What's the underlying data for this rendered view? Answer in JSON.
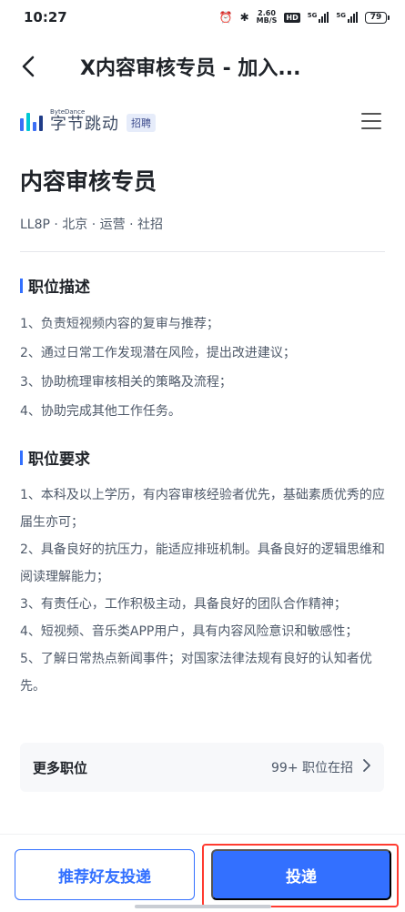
{
  "status_bar": {
    "time": "10:27",
    "net_speed_value": "2.60",
    "net_speed_unit": "MB/S",
    "hd_label": "HD",
    "sig1_label": "5G",
    "sig2_label": "5G",
    "battery": "79"
  },
  "nav": {
    "title": "X内容审核专员 - 加入..."
  },
  "brand": {
    "en": "ByteDance",
    "cn": "字节跳动",
    "tag": "招聘",
    "logo_colors": [
      "#3c6ff5",
      "#00c8d4",
      "#3c6ff5",
      "#1f3c88"
    ]
  },
  "job": {
    "title": "内容审核专员",
    "meta": "LL8P · 北京 · 运营 · 社招"
  },
  "description": {
    "title": "职位描述",
    "items": [
      "1、负责短视频内容的复审与推荐；",
      "2、通过日常工作发现潜在风险，提出改进建议；",
      "3、协助梳理审核相关的策略及流程；",
      "4、协助完成其他工作任务。"
    ]
  },
  "requirements": {
    "title": "职位要求",
    "items": [
      "1、本科及以上学历，有内容审核经验者优先，基础素质优秀的应届生亦可；",
      "2、具备良好的抗压力，能适应排班机制。具备良好的逻辑思维和阅读理解能力；",
      "3、有责任心，工作积极主动，具备良好的团队合作精神；",
      "4、短视频、音乐类APP用户，具有内容风险意识和敏感性；",
      "5、了解日常热点新闻事件；对国家法律法规有良好的认知者优先。"
    ]
  },
  "more": {
    "label": "更多职位",
    "count": "99+ 职位在招"
  },
  "actions": {
    "refer_label": "推荐好友投递",
    "apply_label": "投递"
  },
  "colors": {
    "accent": "#3370ff",
    "highlight": "#ff3b30"
  }
}
